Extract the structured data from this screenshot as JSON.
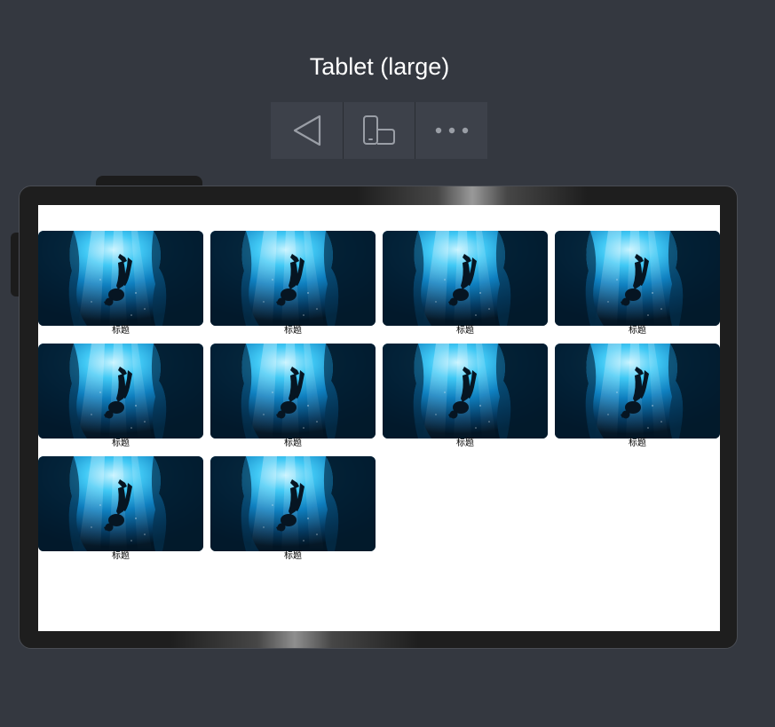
{
  "device": {
    "title": "Tablet (large)"
  },
  "toolbar": {
    "buttons": [
      {
        "name": "back-button",
        "icon": "back-triangle-icon"
      },
      {
        "name": "rotate-device-button",
        "icon": "rotate-device-icon"
      },
      {
        "name": "more-options-button",
        "icon": "more-dots-icon"
      }
    ]
  },
  "colors": {
    "background": "#343840",
    "toolbar": "#3d414a",
    "frame": "#1e1e1e",
    "screen": "#ffffff",
    "icon": "#9a9ea6"
  },
  "gallery": {
    "items": [
      {
        "title": "标题",
        "image": "diver-underwater-cave"
      },
      {
        "title": "标题",
        "image": "diver-underwater-cave"
      },
      {
        "title": "标题",
        "image": "diver-underwater-cave"
      },
      {
        "title": "标题",
        "image": "diver-underwater-cave"
      },
      {
        "title": "标题",
        "image": "diver-underwater-cave"
      },
      {
        "title": "标题",
        "image": "diver-underwater-cave"
      },
      {
        "title": "标题",
        "image": "diver-underwater-cave"
      },
      {
        "title": "标题",
        "image": "diver-underwater-cave"
      },
      {
        "title": "标题",
        "image": "diver-underwater-cave"
      },
      {
        "title": "标题",
        "image": "diver-underwater-cave"
      }
    ]
  }
}
